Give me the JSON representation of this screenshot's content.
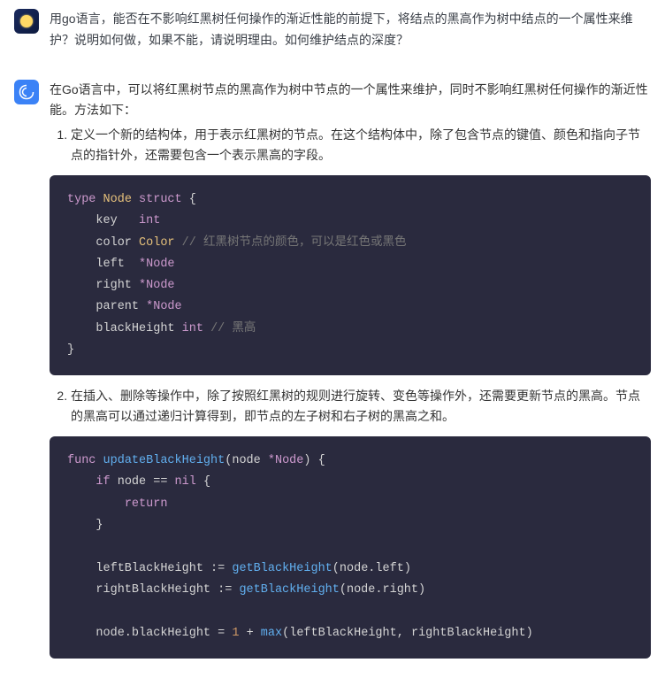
{
  "user_message": {
    "text": "用go语言，能否在不影响红黑树任何操作的渐近性能的前提下，将结点的黑高作为树中结点的一个属性来维护？说明如何做，如果不能，请说明理由。如何维护结点的深度？"
  },
  "ai_message": {
    "intro": "在Go语言中，可以将红黑树节点的黑高作为树中节点的一个属性来维护，同时不影响红黑树任何操作的渐近性能。方法如下：",
    "point1": "定义一个新的结构体，用于表示红黑树的节点。在这个结构体中，除了包含节点的键值、颜色和指向子节点的指针外，还需要包含一个表示黑高的字段。",
    "point2": "在插入、删除等操作中，除了按照红黑树的规则进行旋转、变色等操作外，还需要更新节点的黑高。节点的黑高可以通过递归计算得到，即节点的左子树和右子树的黑高之和。"
  },
  "code1": {
    "kw_type": "type",
    "name_node": "Node",
    "kw_struct": "struct",
    "brace_open": "{",
    "f_key": "key",
    "t_int": "int",
    "f_color": "color",
    "t_color": "Color",
    "comment1": "// 红黑树节点的颜色，可以是红色或黑色",
    "f_left": "left",
    "t_ptr_node": "*Node",
    "f_right": "right",
    "f_parent": "parent",
    "f_bh": "blackHeight",
    "comment2": "// 黑高",
    "brace_close": "}"
  },
  "code2": {
    "kw_func": "func",
    "fn_update": "updateBlackHeight",
    "paren_open": "(",
    "param_node": "node",
    "t_ptr_node": "*Node",
    "paren_close": ")",
    "brace_open": "{",
    "kw_if": "if",
    "var_node": "node",
    "op_eq": "==",
    "kw_nil": "nil",
    "kw_return": "return",
    "brace_close": "}",
    "var_left": "leftBlackHeight",
    "op_walrus": ":=",
    "fn_get": "getBlackHeight",
    "prop_left": "node.left",
    "var_right": "rightBlackHeight",
    "prop_right": "node.right",
    "prop_bh": "node.blackHeight",
    "op_assign": "=",
    "num_1": "1",
    "op_plus": "+",
    "fn_max": "max",
    "comma": ","
  }
}
